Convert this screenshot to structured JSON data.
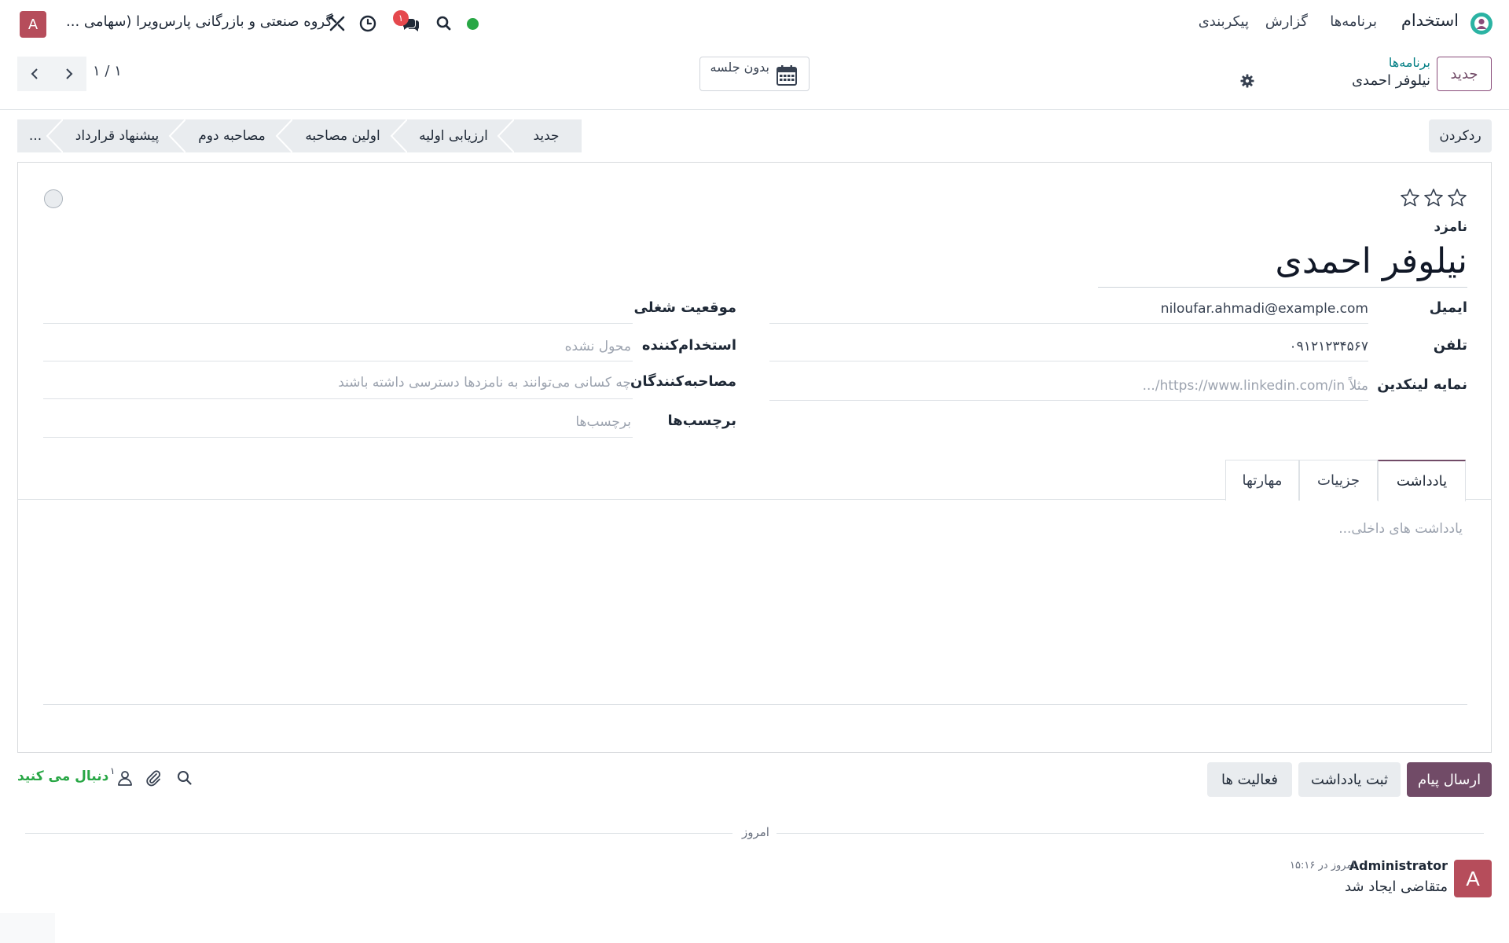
{
  "nav": {
    "brand": "استخدام",
    "menu": [
      "برنامه‌ها",
      "گزارش",
      "پیکربندی"
    ],
    "company": "گروه صنعتی و بازرگانی پارس‌ویرا (سهامی ...",
    "chat_badge": "۱",
    "user_initial": "A",
    "presence_color": "#28a745"
  },
  "control": {
    "new_label": "جدید",
    "breadcrumb_parent": "برنامه‌ها",
    "breadcrumb_current": "نیلوفر احمدی",
    "meeting_label": "بدون جلسه",
    "pager": "۱ / ۱"
  },
  "status": {
    "refuse_label": "ردکردن",
    "stages": [
      "جدید",
      "ارزیابی اولیه",
      "اولین مصاحبه",
      "مصاحبه دوم",
      "پیشنهاد قرارداد",
      "..."
    ],
    "active_stage": "جدید"
  },
  "form": {
    "stars_total": 3,
    "stars_filled": 0,
    "candidate_label": "نامزد",
    "candidate_name": "نیلوفر احمدی",
    "right_fields": [
      {
        "label": "ایمیل",
        "value": "niloufar.ahmadi@example.com",
        "placeholder": ""
      },
      {
        "label": "تلفن",
        "value": "۰۹۱۲۱۲۳۴۵۶۷",
        "placeholder": ""
      },
      {
        "label": "نمایه لینکدین",
        "value": "",
        "placeholder": "مثلاً https://www.linkedin.com/in/..."
      }
    ],
    "left_fields": [
      {
        "label": "موقعیت شغلی",
        "value": "",
        "placeholder": ""
      },
      {
        "label": "استخدام‌کننده",
        "value": "",
        "placeholder": "محول نشده"
      },
      {
        "label": "مصاحبه‌کنندگان",
        "value": "",
        "placeholder": "چه کسانی می‌توانند به نامزدها دسترسی داشته باشند"
      },
      {
        "label": "برچسب‌ها",
        "value": "",
        "placeholder": "برچسب‌ها"
      }
    ],
    "tabs": [
      "یادداشت",
      "جزییات",
      "مهارتها"
    ],
    "active_tab": "یادداشت",
    "note_placeholder": "یادداشت های داخلی..."
  },
  "chatter": {
    "send_label": "ارسال پیام",
    "log_label": "ثبت یادداشت",
    "activity_label": "فعالیت ها",
    "following_label": "دنبال می کنید",
    "followers_count": "۱",
    "today_label": "امروز",
    "message": {
      "author_initial": "A",
      "author": "Administrator",
      "date": "امروز در ۱۵:۱۶",
      "body": "متقاضی ایجاد شد"
    }
  },
  "colors": {
    "brand": "#714b67",
    "avatar": "#b64d5b",
    "link": "#017e84",
    "success": "#28a745",
    "badge": "#e5484d"
  }
}
